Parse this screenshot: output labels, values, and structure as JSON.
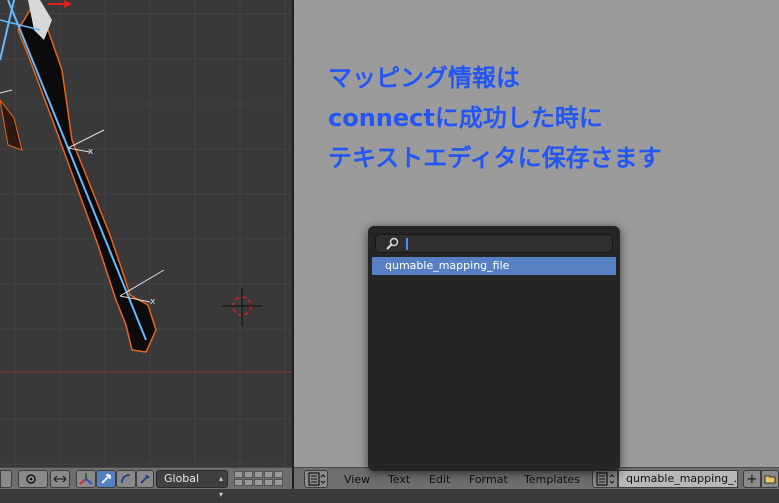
{
  "viewport3d": {
    "header": {
      "orientation": "Global"
    }
  },
  "annotation": {
    "lines": [
      "マッピング情報は",
      "connectに成功した時に",
      "テキストエディタに保存さます"
    ],
    "color": "#2356f4"
  },
  "text_editor": {
    "header": {
      "menus": [
        "View",
        "Text",
        "Edit",
        "Format",
        "Templates"
      ],
      "textblock_name": "qumable_mapping_..."
    },
    "popup": {
      "search_value": "",
      "items": [
        "qumable_mapping_file"
      ]
    }
  },
  "icons": {
    "editor_type": "text-editor-icon",
    "search": "search-icon",
    "new": "plus-icon",
    "open": "folder-icon",
    "cursor": "3d-cursor-icon"
  },
  "colors": {
    "viewport_bg": "#393939",
    "text_bg": "#9b9b9b",
    "selection": "#5680c2"
  }
}
